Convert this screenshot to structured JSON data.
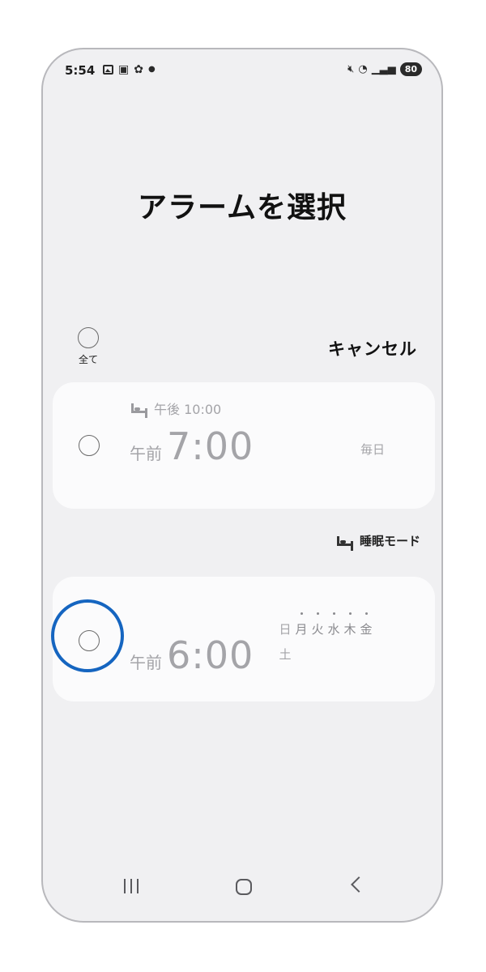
{
  "status_bar": {
    "time": "5:54",
    "left_icons": [
      "photo-icon",
      "device-icon",
      "gear-icon",
      "dot-icon"
    ],
    "right_icons": [
      "mute-icon",
      "wifi-icon",
      "signal-icon"
    ],
    "battery": "80"
  },
  "title": "アラームを選択",
  "select_all_label": "全て",
  "cancel_label": "キャンセル",
  "alarms": [
    {
      "bedtime_label": "午後 10:00",
      "ampm": "午前",
      "time": "7:00",
      "repeat": "毎日"
    },
    {
      "ampm": "午前",
      "time": "6:00",
      "days": [
        "日",
        "月",
        "火",
        "水",
        "木",
        "金"
      ],
      "active_days": [
        "月",
        "火",
        "水",
        "木",
        "金"
      ],
      "days_second_row": "土"
    }
  ],
  "sleep_mode_label": "睡眠モード",
  "nav": {
    "recent": "recent-apps-icon",
    "home": "home-icon",
    "back": "back-icon"
  },
  "colors": {
    "background": "#f0f0f2",
    "card": "#fbfbfc",
    "highlight": "#1565c0",
    "muted_text": "#a4a4a8"
  }
}
